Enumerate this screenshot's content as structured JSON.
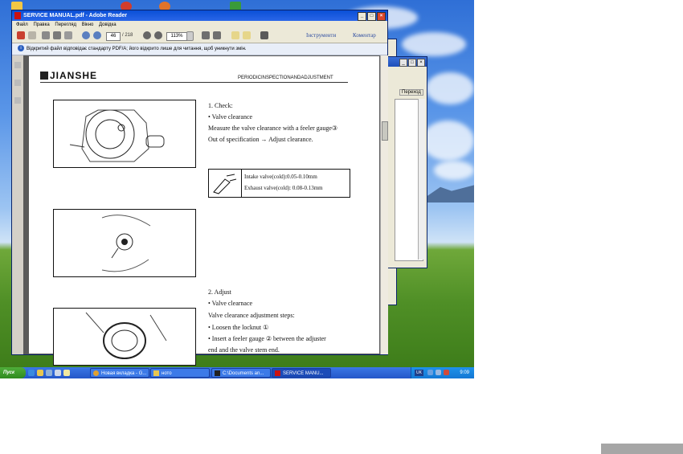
{
  "window": {
    "title": "SERVICE MANUAL.pdf - Adobe Reader",
    "menu": [
      "Файл",
      "Правка",
      "Перегляд",
      "Вікно",
      "Довідка"
    ]
  },
  "toolbar": {
    "page_current": "46",
    "page_total": "/ 218",
    "zoom": "113%",
    "tools_label": "Інструменти",
    "comment_label": "Коментар"
  },
  "infobar": {
    "message": "Відкритий файл відповідає стандарту PDF/A; його відкрито лише для читання, щоб уникнути змін."
  },
  "page": {
    "brand": "JIANSHE",
    "section": "PERIODICINSPECTIONANDADJUSTMENT",
    "check_heading": "1. Check:",
    "check_item": "•  Valve clearance",
    "check_line1": "Measure the valve clearance with a feeler gauge③",
    "check_line2": "Out of specification → Adjust clearance.",
    "spec_intake": "Intake valve(cold):0.05-0.10mm",
    "spec_exhaust": "Exhaust valve(cold): 0.08-0.13mm",
    "adjust_heading": "2. Adjust",
    "adjust_item": "•  Valve clearnace",
    "adjust_steps": "Valve clearance adjustment steps:",
    "step1": "•  Loosen the locknut ①",
    "step2": "•  Insert a feeler gauge ② between the adjuster",
    "step2_cont": "end and the valve stem end."
  },
  "background_window": {
    "button": "Переход"
  },
  "taskbar": {
    "start": "Пуск",
    "tasks": [
      "Новая вкладка - G...",
      "ното",
      "C:\\Documents an...",
      "SERVICE MANU..."
    ],
    "lang": "UK",
    "clock": "9:09"
  }
}
